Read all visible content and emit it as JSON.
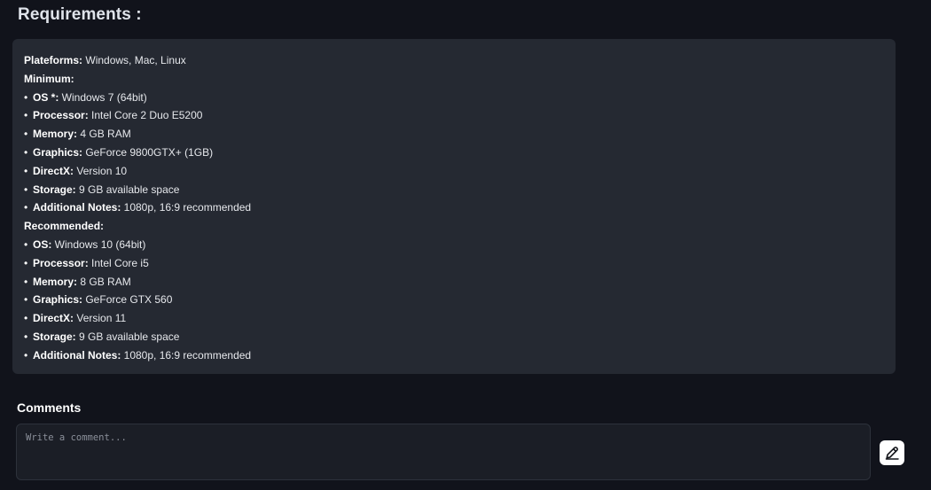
{
  "header": {
    "title": "Requirements :"
  },
  "requirements": {
    "platforms": {
      "key": "Plateforms:",
      "value": " Windows, Mac, Linux"
    },
    "minimum": {
      "heading": "Minimum:",
      "items": [
        {
          "key": "OS *:",
          "value": " Windows 7 (64bit)"
        },
        {
          "key": "Processor:",
          "value": " Intel Core 2 Duo E5200"
        },
        {
          "key": "Memory:",
          "value": " 4 GB RAM"
        },
        {
          "key": "Graphics:",
          "value": " GeForce 9800GTX+ (1GB)"
        },
        {
          "key": "DirectX:",
          "value": " Version 10"
        },
        {
          "key": "Storage:",
          "value": " 9 GB available space"
        },
        {
          "key": "Additional Notes:",
          "value": " 1080p, 16:9 recommended"
        }
      ]
    },
    "recommended": {
      "heading": "Recommended:",
      "items": [
        {
          "key": "OS:",
          "value": " Windows 10 (64bit)"
        },
        {
          "key": "Processor:",
          "value": " Intel Core i5"
        },
        {
          "key": "Memory:",
          "value": " 8 GB RAM"
        },
        {
          "key": "Graphics:",
          "value": " GeForce GTX 560"
        },
        {
          "key": "DirectX:",
          "value": " Version 11"
        },
        {
          "key": "Storage:",
          "value": " 9 GB available space"
        },
        {
          "key": "Additional Notes:",
          "value": " 1080p, 16:9 recommended"
        }
      ]
    }
  },
  "comments": {
    "title": "Comments",
    "placeholder": "Write a comment...",
    "value": "",
    "submit_icon": "pencil-icon"
  },
  "colors": {
    "page_bg": "#11131b",
    "card_bg": "#252932",
    "input_bg": "#1b1e26",
    "button_bg": "#ffffff"
  }
}
